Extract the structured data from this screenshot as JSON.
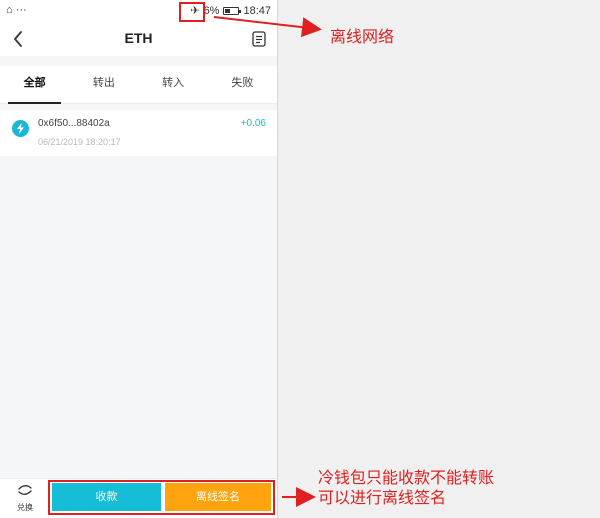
{
  "statusbar": {
    "left": "⌂ ···",
    "battery_pct": "6%",
    "time": "18:47"
  },
  "navbar": {
    "title": "ETH"
  },
  "tabs": [
    {
      "label": "全部"
    },
    {
      "label": "转出"
    },
    {
      "label": "转入"
    },
    {
      "label": "失败"
    }
  ],
  "transactions": [
    {
      "address": "0x6f50...88402a",
      "time": "06/21/2019 18:20:17",
      "amount": "+0.06"
    }
  ],
  "bottombar": {
    "exchange_label": "兑换",
    "receive_label": "收款",
    "offline_sign_label": "离线签名"
  },
  "annotations": {
    "offline_network": "离线网络",
    "cold_wallet_line1": "冷钱包只能收款不能转账",
    "cold_wallet_line2": "可以进行离线签名"
  },
  "colors": {
    "accent": "#15bdd6",
    "orange": "#ffa30e",
    "annotation": "#e02020"
  }
}
